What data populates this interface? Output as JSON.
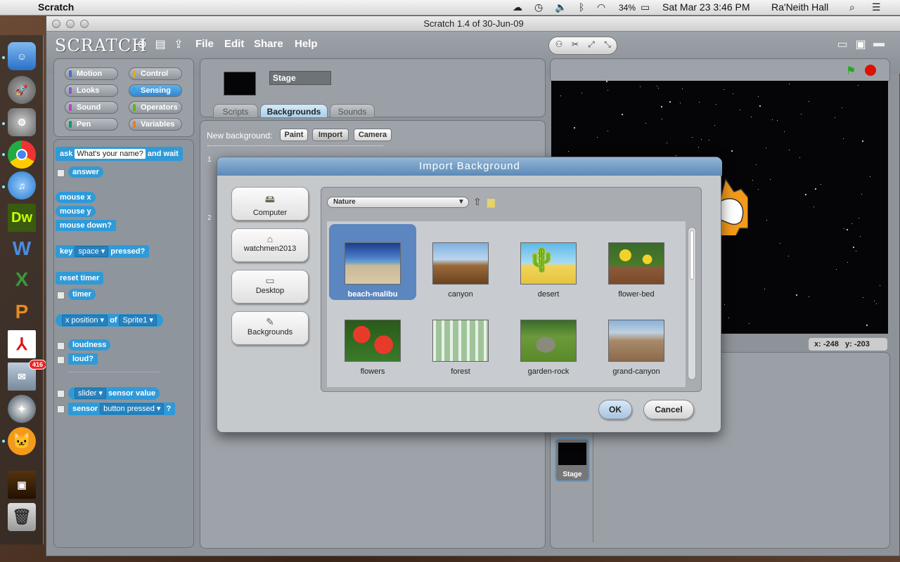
{
  "menubar": {
    "app_name": "Scratch",
    "battery": "34%",
    "datetime": "Sat Mar 23  3:46 PM",
    "user": "Ra'Neith Hall"
  },
  "dock": {
    "items": [
      "Finder",
      "Launchpad",
      "System Preferences",
      "Chrome",
      "iTunes",
      "Dreamweaver",
      "Word",
      "Excel",
      "PowerPoint",
      "Acrobat",
      "Mail",
      "Safari",
      "Scratch",
      "Photo Booth",
      "Trash"
    ],
    "mail_badge": "416",
    "dw_label": "Dw"
  },
  "window": {
    "title": "Scratch 1.4 of 30-Jun-09"
  },
  "toolbar": {
    "logo": "SCRATCH",
    "menus": [
      "File",
      "Edit",
      "Share",
      "Help"
    ]
  },
  "categories": [
    {
      "label": "Motion",
      "color": "#4a6cd4"
    },
    {
      "label": "Control",
      "color": "#e1a91a"
    },
    {
      "label": "Looks",
      "color": "#8a55d7"
    },
    {
      "label": "Sensing",
      "color": "#2ca5e2"
    },
    {
      "label": "Sound",
      "color": "#bb42c3"
    },
    {
      "label": "Operators",
      "color": "#5cb712"
    },
    {
      "label": "Pen",
      "color": "#0e9a6c"
    },
    {
      "label": "Variables",
      "color": "#ee7d16"
    }
  ],
  "blocks": {
    "ask": "ask",
    "ask_value": "What's your name?",
    "and_wait": "and wait",
    "answer": "answer",
    "mouse_x": "mouse x",
    "mouse_y": "mouse y",
    "mouse_down": "mouse down?",
    "key": "key",
    "key_value": "space",
    "pressed": "pressed?",
    "reset_timer": "reset timer",
    "timer": "timer",
    "x_position": "x position",
    "of": "of",
    "sprite": "Sprite1",
    "loudness": "loudness",
    "loud": "loud?",
    "slider": "slider",
    "sensor_value": "sensor value",
    "sensor": "sensor",
    "button_pressed": "button pressed",
    "question": "?"
  },
  "sprite_info": {
    "name": "Stage"
  },
  "tabs": [
    "Scripts",
    "Backgrounds",
    "Sounds"
  ],
  "backgrounds": {
    "new_label": "New background:",
    "buttons": [
      "Paint",
      "Import",
      "Camera"
    ],
    "numbers": [
      "1",
      "2"
    ]
  },
  "stage": {
    "x_label": "x:",
    "x_value": "-248",
    "y_label": "y:",
    "y_value": "-203",
    "thumb_label": "Stage"
  },
  "dialog": {
    "title": "Import Background",
    "locations": [
      "Computer",
      "watchmen2013",
      "Desktop",
      "Backgrounds"
    ],
    "folder": "Nature",
    "files": [
      "beach-malibu",
      "canyon",
      "desert",
      "flower-bed",
      "flowers",
      "forest",
      "garden-rock",
      "grand-canyon"
    ],
    "selected": "beach-malibu",
    "ok": "OK",
    "cancel": "Cancel"
  }
}
